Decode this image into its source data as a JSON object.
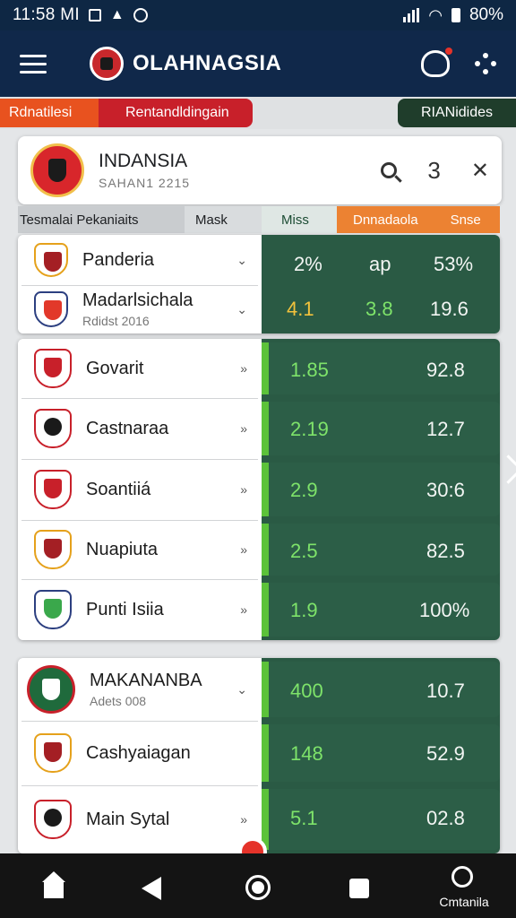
{
  "status_bar": {
    "time": "11:58 MI",
    "battery": "80%"
  },
  "app_bar": {
    "title": "OLAHNAGSIA"
  },
  "filter_tabs": [
    "Rdnatilesi",
    "Rentandldingain",
    "RIANidides"
  ],
  "country": {
    "name": "INDANSIA",
    "season": "SAHAN1 2215",
    "count": "3"
  },
  "columns": [
    "Tesmalai Pekaniaits",
    "Mask",
    "Miss",
    "Dnnadaola",
    "Snse"
  ],
  "card1": {
    "rows": [
      {
        "name": "Panderia",
        "v1": "2%",
        "v2": "ap",
        "v3": "53%"
      },
      {
        "name": "Madarlsichala",
        "sub": "Rdidst 2016",
        "v1": "4.1",
        "v2": "3.8",
        "v3": "19.6"
      }
    ]
  },
  "card2": {
    "rows": [
      {
        "name": "Govarit",
        "v1": "1.85",
        "v3": "92.8"
      },
      {
        "name": "Castnaraa",
        "v1": "2.19",
        "v3": "12.7"
      },
      {
        "name": "Soantiiá",
        "v1": "2.9",
        "v3": "30:6"
      },
      {
        "name": "Nuapiuta",
        "v1": "2.5",
        "v3": "82.5"
      },
      {
        "name": "Punti Isiia",
        "v1": "1.9",
        "v3": "100%"
      }
    ]
  },
  "card3": {
    "rows": [
      {
        "name": "MAKANANBA",
        "sub": "Adets 008",
        "v1": "400",
        "v3": "10.7"
      },
      {
        "name": "Cashyaiagan",
        "v1": "148",
        "v3": "52.9"
      },
      {
        "name": "Main Sytal",
        "v1": "5.1",
        "v3": "02.8"
      }
    ]
  },
  "nav": {
    "label": "Cmtanila"
  },
  "colors": {
    "header": "#10284a",
    "accent_orange": "#e8521f",
    "accent_red": "#c8202a",
    "panel_green": "#2a5a44",
    "value_green": "#7ee36a"
  }
}
